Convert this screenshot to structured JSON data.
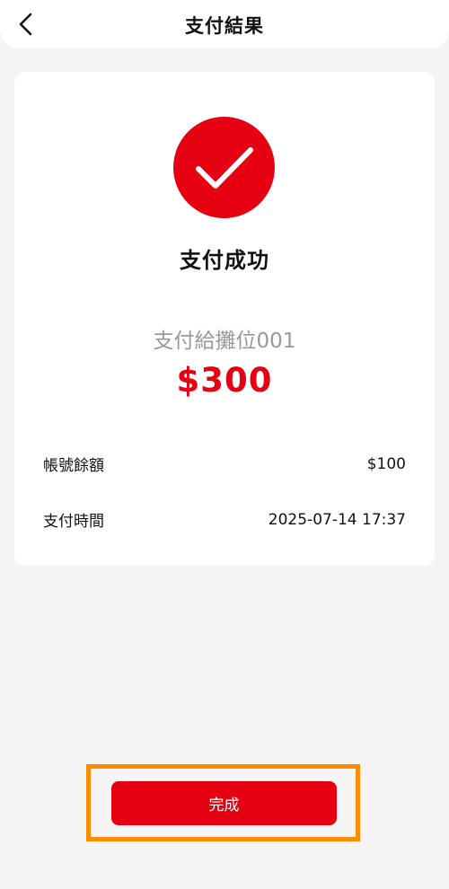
{
  "header": {
    "title": "支付結果",
    "back_icon": "chevron-left-icon"
  },
  "result": {
    "icon": "check-icon",
    "status": "支付成功",
    "payee": "支付給攤位001",
    "amount": "$300"
  },
  "details": {
    "balance_label": "帳號餘額",
    "balance_value": "$100",
    "time_label": "支付時間",
    "time_value": "2025-07-14 17:37"
  },
  "actions": {
    "done_label": "完成"
  },
  "colors": {
    "accent": "#e50012",
    "highlight": "#ff8c00",
    "background": "#f5f5f5"
  }
}
